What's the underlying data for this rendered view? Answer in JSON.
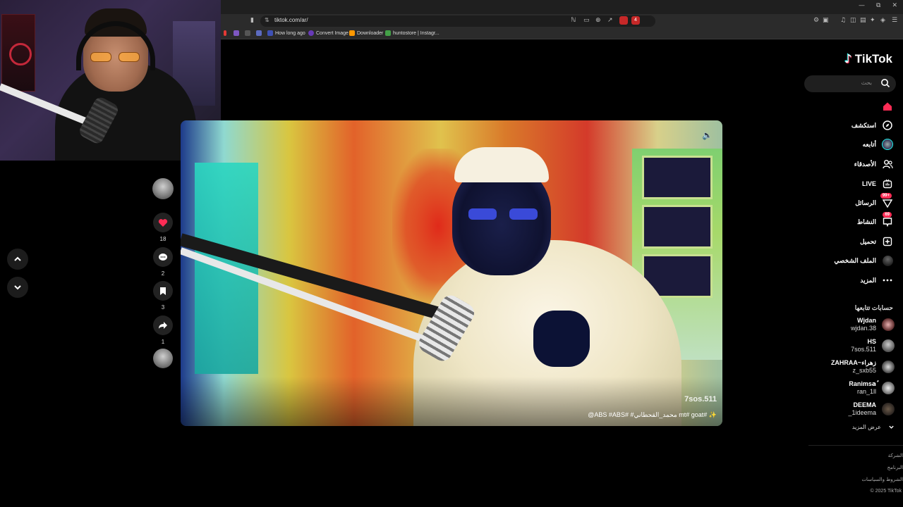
{
  "browser": {
    "url": "tiktok.com/ar/",
    "ext_badge": "4",
    "bookmarks": [
      {
        "label": "How long ago",
        "color": "#3f51b5"
      },
      {
        "label": "Convert Image",
        "color": "#673ab7"
      },
      {
        "label": "Downloader",
        "color": "#ff9800"
      },
      {
        "label": "huntostore | Instagr...",
        "color": "#43a047"
      }
    ]
  },
  "actions": {
    "like_count": "18",
    "comment_count": "2",
    "save_count": "3",
    "share_count": "1"
  },
  "video": {
    "watermark": "7sos.511",
    "caption": "@ABS #ABS# #محمد_القحطاني mt# goat# ✨"
  },
  "sidebar": {
    "logo": "TikTok",
    "search_placeholder": "بحث",
    "nav": [
      {
        "label": "",
        "icon": "home-icon",
        "color": "#fe2c55"
      },
      {
        "label": "استكشف",
        "icon": "compass-icon"
      },
      {
        "label": "أتابعه",
        "icon": "following-avatar-icon"
      },
      {
        "label": "الأصدقاء",
        "icon": "friends-icon"
      },
      {
        "label": "LIVE",
        "icon": "live-icon"
      },
      {
        "label": "الرسائل",
        "icon": "messages-icon",
        "badge": "99+"
      },
      {
        "label": "النشاط",
        "icon": "activity-icon",
        "badge": "69"
      },
      {
        "label": "تحميل",
        "icon": "upload-icon"
      },
      {
        "label": "الملف الشخصي",
        "icon": "profile-icon"
      },
      {
        "label": "المزيد",
        "icon": "more-icon"
      }
    ],
    "following_title": "حسابات تتابعها",
    "following": [
      {
        "name": "Wjdan",
        "user": "wjdan.38"
      },
      {
        "name": "HS",
        "user": "7sos.511"
      },
      {
        "name": "ZAHRAA~زهراء",
        "user": "z_sxb55"
      },
      {
        "name": "Ranimsaٌ",
        "user": "ran_1ll"
      },
      {
        "name": "DEEMA",
        "user": "_1ideema"
      }
    ],
    "see_more": "عرض المزيد",
    "footer": [
      "الشركة",
      "البرنامج",
      "الشروط والسياسات",
      "© 2025 TikTok"
    ]
  }
}
